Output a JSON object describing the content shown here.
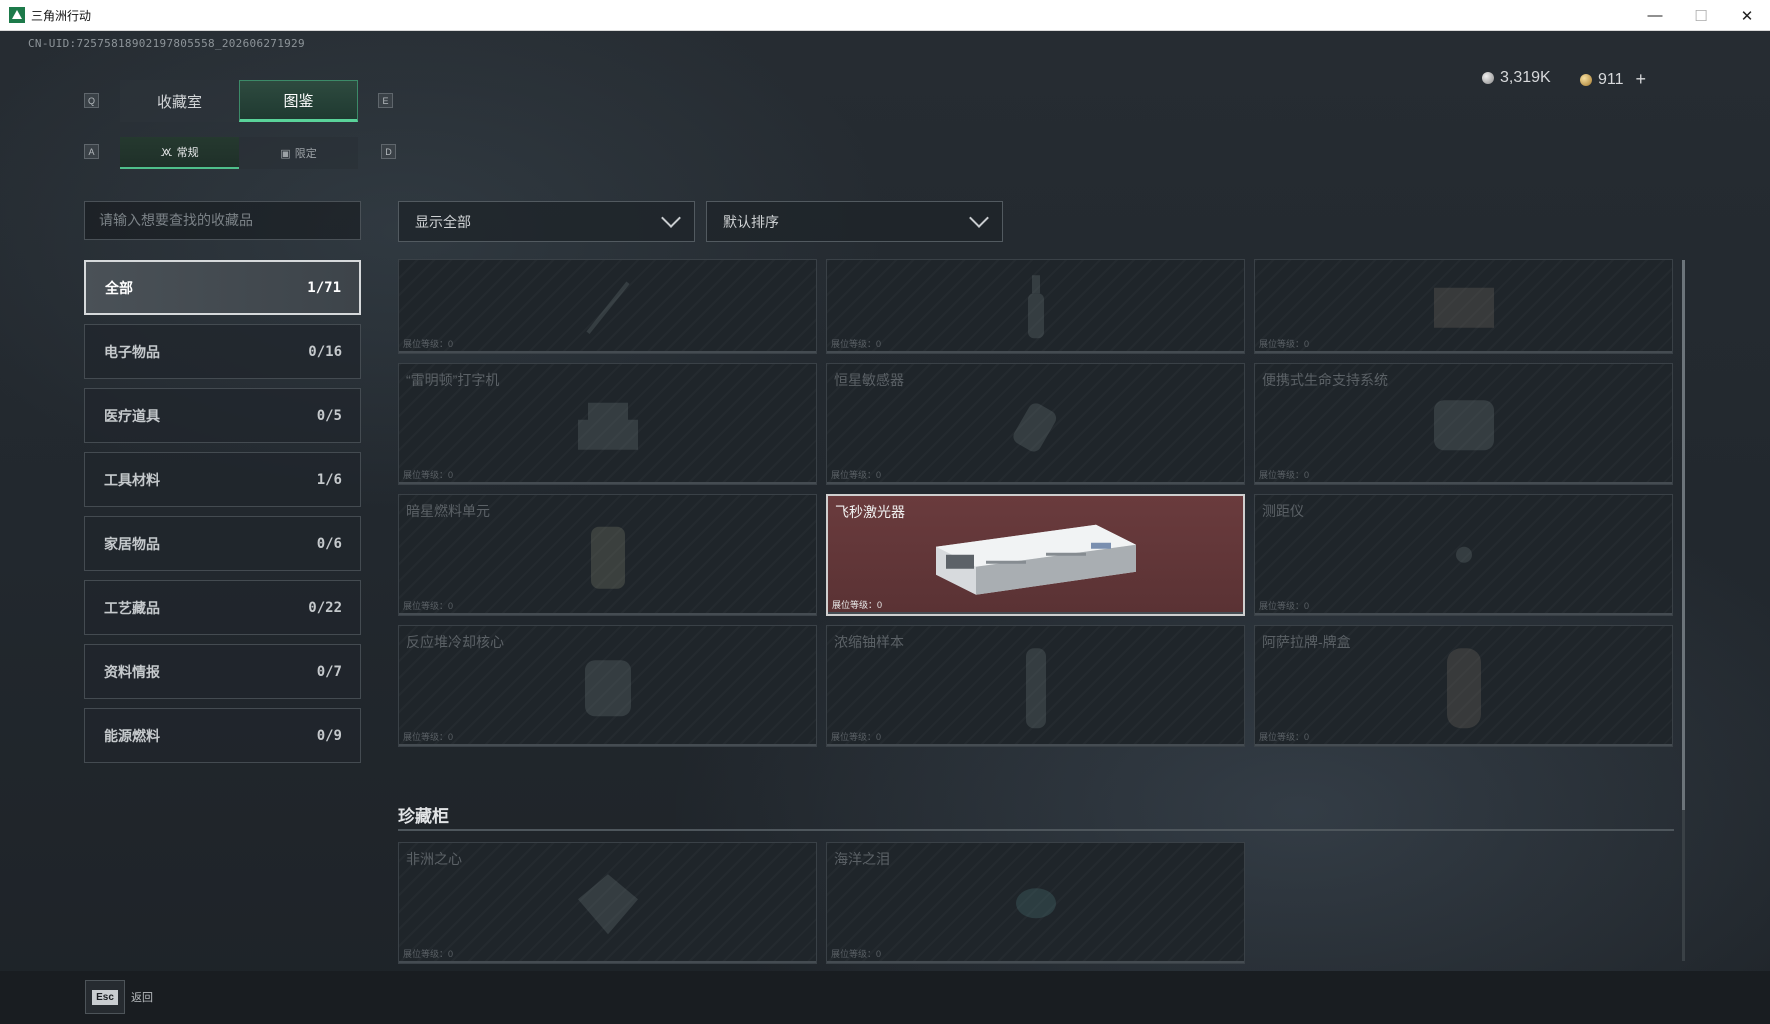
{
  "window": {
    "title": "三角洲行动",
    "minimize": "—",
    "maximize": "☐",
    "close": "✕"
  },
  "header": {
    "uid": "CN-UID:725758189021978055​58_202606271929",
    "currency_silver": "3,319K",
    "currency_gold": "911",
    "currency_add": "+"
  },
  "key_hints": {
    "q": "Q",
    "e": "E",
    "a": "A",
    "d": "D"
  },
  "main_tabs": [
    {
      "label": "收藏室"
    },
    {
      "label": "图鉴"
    }
  ],
  "sub_tabs": [
    {
      "label": "常规"
    },
    {
      "label": "限定"
    }
  ],
  "search": {
    "placeholder": "请输入想要查找的收藏品"
  },
  "categories": [
    {
      "label": "全部",
      "count": "1/71"
    },
    {
      "label": "电子物品",
      "count": "0/16"
    },
    {
      "label": "医疗道具",
      "count": "0/5"
    },
    {
      "label": "工具材料",
      "count": "1/6"
    },
    {
      "label": "家居物品",
      "count": "0/6"
    },
    {
      "label": "工艺藏品",
      "count": "0/22"
    },
    {
      "label": "资料情报",
      "count": "0/7"
    },
    {
      "label": "能源燃料",
      "count": "0/9"
    }
  ],
  "filters": {
    "show": "显示全部",
    "sort": "默认排序"
  },
  "cards": [
    {
      "name": "",
      "level": "展位等级：0"
    },
    {
      "name": "",
      "level": "展位等级：0"
    },
    {
      "name": "",
      "level": "展位等级：0"
    },
    {
      "name": "“雷明顿”打字机",
      "level": "展位等级：0"
    },
    {
      "name": "恒星敏感器",
      "level": "展位等级：0"
    },
    {
      "name": "便携式生命支持系统",
      "level": "展位等级：0"
    },
    {
      "name": "暗星燃料单元",
      "level": "展位等级：0"
    },
    {
      "name": "飞秒激光器",
      "level": "展位等级：0"
    },
    {
      "name": "测距仪",
      "level": "展位等级：0"
    },
    {
      "name": "反应堆冷却核心",
      "level": "展位等级：0"
    },
    {
      "name": "浓缩铀样本",
      "level": "展位等级：0"
    },
    {
      "name": "阿萨拉牌-牌盒",
      "level": "展位等级：0"
    }
  ],
  "treasure_section": {
    "title": "珍藏柜",
    "cards": [
      {
        "name": "非洲之心",
        "level": "展位等级：0"
      },
      {
        "name": "海洋之泪",
        "level": "展位等级：0"
      }
    ]
  },
  "footer": {
    "esc_key": "Esc",
    "esc_label": "返回"
  },
  "colors": {
    "accent": "#5ad39a",
    "selected_card": "#6a3b3d"
  }
}
